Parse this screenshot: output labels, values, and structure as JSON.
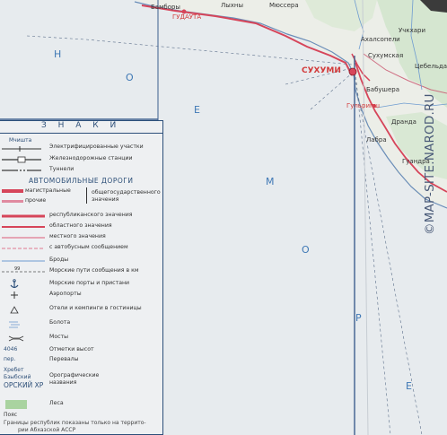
{
  "map": {
    "sea_letters_left": [
      "Н",
      "О",
      "Е"
    ],
    "sea_letters_right": [
      "М",
      "О",
      "Р",
      "Е"
    ],
    "places": {
      "sukhumi": "СУХУМИ",
      "gudauta": "ГУДАУТА",
      "gulripsh": "Гульрипш",
      "p1": "Бамборы",
      "p2": "Мюссера",
      "p3": "Лыхны",
      "p4": "Сухумская",
      "p5": "Бабушера",
      "p6": "Дранда",
      "p7": "Учкхари",
      "p8": "Лабра",
      "p9": "Гуандра",
      "p10": "Ахалсопели",
      "p11": "Цебельда"
    }
  },
  "legend": {
    "title": "З Н А К И",
    "rows": [
      {
        "text": "Электрифицированные участки",
        "symlabel": "Мчишта"
      },
      {
        "text": "Железнодорожные станции",
        "symlabel": ""
      },
      {
        "text": "Туннели",
        "symlabel": ""
      }
    ],
    "roads_title": "АВТОМОБИЛЬНЫЕ ДОРОГИ",
    "roads_brace": {
      "a": "магистральные",
      "b": "прочие",
      "c": "общегосударственного значения"
    },
    "road_rows": [
      "республиканского значения",
      "областного значения",
      "местного значения",
      "с автобусным сообщением",
      "Броды",
      "Морские пути сообщения в км",
      "Морские порты и пристани",
      "Аэропорты",
      "Отели и кемпинги в гостиницы",
      "Болота",
      "Мосты",
      "Отметки высот",
      "Перевалы",
      "Орографические названия",
      "Леса"
    ],
    "sym_labels": {
      "height": "4046",
      "pass": "пер.",
      "oro1": "Хребет",
      "oro2": "Бзыбский",
      "oro3": "ОРСКИЙ ХР"
    },
    "footnote1": "Границы республик показаны только на террито-",
    "footnote2": "рии Абхазской АССР",
    "footnote_left": "Пояс"
  },
  "watermark": "©MAP-SITE.NAROD.RU",
  "colors": {
    "sea": "#e7ebee",
    "land": "#eaece6",
    "road_red": "#d6455a",
    "grid": "#2e5b8c",
    "sea_text": "#3f78b5"
  }
}
